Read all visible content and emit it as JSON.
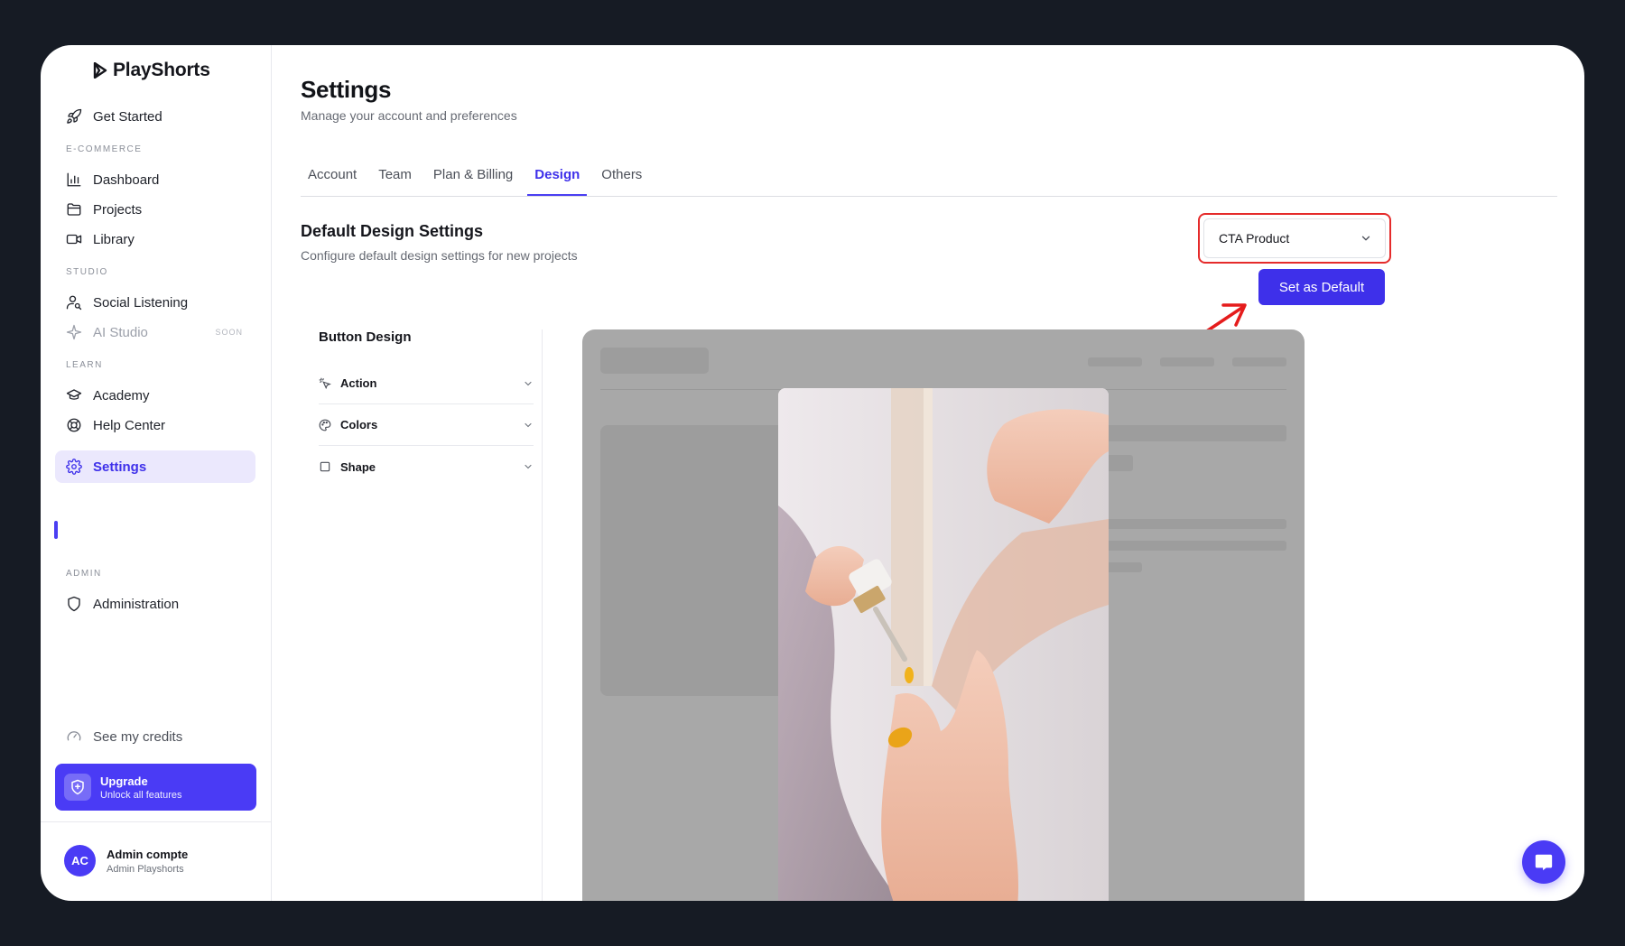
{
  "brand": {
    "name": "PlayShorts"
  },
  "sidebar": {
    "get_started": "Get Started",
    "sections": {
      "ecommerce": "E-COMMERCE",
      "studio": "STUDIO",
      "learn": "LEARN",
      "admin": "ADMIN"
    },
    "items": {
      "dashboard": "Dashboard",
      "projects": "Projects",
      "library": "Library",
      "social_listening": "Social Listening",
      "ai_studio": "AI Studio",
      "ai_studio_badge": "SOON",
      "academy": "Academy",
      "help_center": "Help Center",
      "settings": "Settings",
      "administration": "Administration"
    },
    "credits": "See my credits",
    "upgrade": {
      "title": "Upgrade",
      "subtitle": "Unlock all features"
    },
    "user": {
      "initials": "AC",
      "name": "Admin compte",
      "role": "Admin Playshorts"
    }
  },
  "header": {
    "title": "Settings",
    "subtitle": "Manage your account and preferences"
  },
  "tabs": [
    {
      "label": "Account",
      "active": false
    },
    {
      "label": "Team",
      "active": false
    },
    {
      "label": "Plan & Billing",
      "active": false
    },
    {
      "label": "Design",
      "active": true
    },
    {
      "label": "Others",
      "active": false
    }
  ],
  "design": {
    "title": "Default Design Settings",
    "subtitle": "Configure default design settings for new projects",
    "template_select": "CTA Product",
    "set_default": "Set as Default",
    "panel_title": "Button Design",
    "accordions": [
      "Action",
      "Colors",
      "Shape"
    ]
  },
  "colors": {
    "accent": "#3e30ea",
    "highlight": "#e52b2b",
    "background": "#161b24"
  }
}
